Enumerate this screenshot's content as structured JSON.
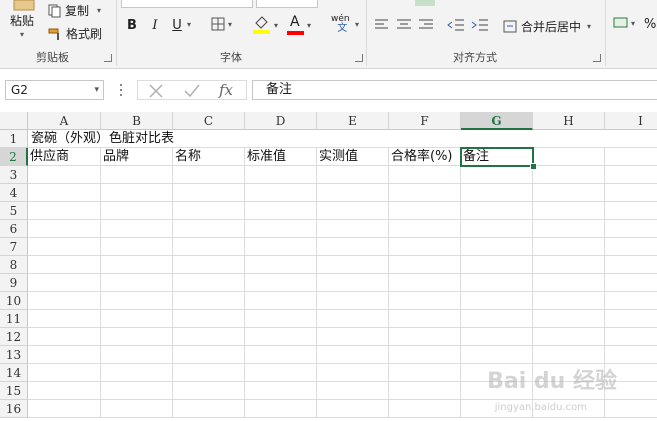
{
  "ribbon": {
    "clipboard": {
      "paste": "粘贴",
      "copy": "复制",
      "format_painter": "格式刷",
      "label": "剪贴板"
    },
    "font": {
      "bold": "B",
      "italic": "I",
      "underline": "U",
      "font_color": "A",
      "phonetic": "wén",
      "phonetic_sub": "文",
      "label": "字体",
      "fill_color": "#ffff00",
      "text_color": "#ff0000"
    },
    "alignment": {
      "merge_center": "合并后居中",
      "label": "对齐方式"
    },
    "number": {
      "percent": "%"
    }
  },
  "formula_bar": {
    "name_box": "G2",
    "content": "备注",
    "fx": "fx"
  },
  "grid": {
    "columns": [
      "A",
      "B",
      "C",
      "D",
      "E",
      "F",
      "G",
      "H",
      "I"
    ],
    "rows": [
      "1",
      "2",
      "3",
      "4",
      "5",
      "6",
      "7",
      "8",
      "9",
      "10",
      "11",
      "12",
      "13",
      "14",
      "15",
      "16"
    ],
    "selected_column": "G",
    "selected_row": "2",
    "title": "瓷碗（外观）色脏对比表",
    "headers": [
      "供应商",
      "品牌",
      "名称",
      "标准值",
      "实测值",
      "合格率(%)",
      "备注"
    ]
  },
  "watermark": {
    "text": "Bai du 经验",
    "sub": "jingyan.baidu.com"
  }
}
